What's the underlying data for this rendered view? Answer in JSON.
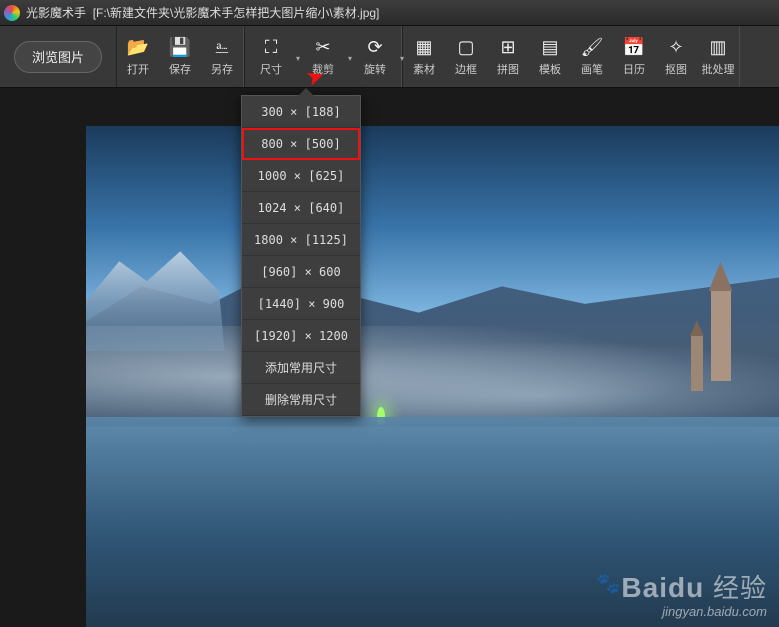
{
  "title": {
    "app_name": "光影魔术手",
    "file_path": "[F:\\新建文件夹\\光影魔术手怎样把大图片缩小\\素材.jpg]"
  },
  "toolbar": {
    "browse_label": "浏览图片",
    "open": "打开",
    "save": "保存",
    "saveas": "另存",
    "size": "尺寸",
    "crop": "裁剪",
    "rotate": "旋转",
    "material": "素材",
    "border": "边框",
    "collage": "拼图",
    "template": "模板",
    "brush": "画笔",
    "calendar": "日历",
    "cutout": "抠图",
    "batch": "批处理"
  },
  "size_menu": {
    "items": [
      {
        "label": "300 × [188]",
        "hl": false
      },
      {
        "label": "800 × [500]",
        "hl": true
      },
      {
        "label": "1000 × [625]",
        "hl": false
      },
      {
        "label": "1024 × [640]",
        "hl": false
      },
      {
        "label": "1800 × [1125]",
        "hl": false
      },
      {
        "label": "[960] × 600",
        "hl": false
      },
      {
        "label": "[1440] × 900",
        "hl": false
      },
      {
        "label": "[1920] × 1200",
        "hl": false
      }
    ],
    "add_label": "添加常用尺寸",
    "del_label": "删除常用尺寸"
  },
  "watermark": {
    "logo_text": "Baidu",
    "logo_cn": "经验",
    "sub": "jingyan.baidu.com"
  }
}
